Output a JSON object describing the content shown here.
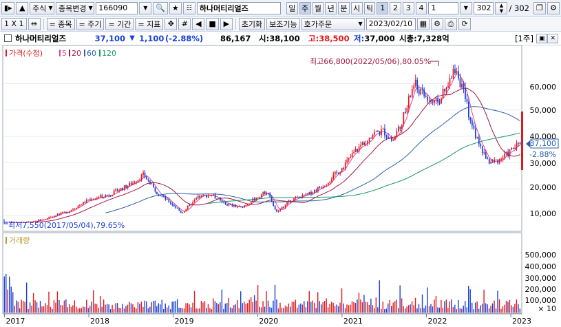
{
  "toolbar1": {
    "market": "주식",
    "change_label": "종목변경",
    "code": "166090",
    "name": "하나머티리얼즈",
    "periods": [
      "일",
      "주",
      "월",
      "년",
      "분",
      "시",
      "틱"
    ],
    "active_period": "주",
    "numbers": [
      "1",
      "2",
      "3",
      "4"
    ],
    "active_number": "1",
    "interval": "1",
    "count": "302",
    "total": "/ 302"
  },
  "toolbar2": {
    "scale": "1 X 1",
    "items": [
      "= 종목",
      "= 주기",
      "= 기간",
      "= 지표"
    ],
    "reset": "초기화",
    "assist": "보조기능",
    "order": "호가주문",
    "date": "2023/02/10"
  },
  "info": {
    "name": "하나머티리얼즈",
    "price": "37,100",
    "down_arrow": "▼",
    "change": "1,100",
    "pct": "(-2.88%)",
    "volume": "86,167",
    "open_label": "시:",
    "open": "38,100",
    "high_label": "고:",
    "high": "38,500",
    "low_label": "저:",
    "low": "37,000",
    "cap": "시총:7,328억",
    "period_tag": "[1주]"
  },
  "legend": {
    "price": "가격(수정)",
    "ma5": "5",
    "ma20": "20",
    "ma60": "60",
    "ma120": "120",
    "volume": "거래량"
  },
  "annotations": {
    "max": "최고66,800(2022/05/06),80.05%",
    "min": "최저7,550(2017/05/04),79.65%"
  },
  "price_axis": {
    "ticks": [
      "60,000",
      "50,000",
      "40,000",
      "30,000",
      "20,000",
      "10,000"
    ],
    "current": "37,100",
    "change_pct": "-2.88%"
  },
  "volume_axis": {
    "ticks": [
      "500,000",
      "400,000",
      "300,000",
      "200,000",
      "100,000"
    ],
    "multiplier": "× 10"
  },
  "x_axis": {
    "years": [
      "2017",
      "2018",
      "2019",
      "2020",
      "2021",
      "2022",
      "2023"
    ]
  },
  "colors": {
    "up": "#e0191e",
    "down": "#1a3fd6",
    "ma5": "#e8409a",
    "ma20": "#a0163c",
    "ma60": "#2c5fa8",
    "ma120": "#159663"
  },
  "chart_data": {
    "type": "candlestick",
    "price_range": [
      7550,
      66800
    ],
    "price_path": [
      [
        2017.3,
        7550
      ],
      [
        2017.5,
        9000
      ],
      [
        2017.75,
        11500
      ],
      [
        2018.0,
        16000
      ],
      [
        2018.25,
        18000
      ],
      [
        2018.5,
        22000
      ],
      [
        2018.65,
        25500
      ],
      [
        2018.8,
        19000
      ],
      [
        2019.0,
        14000
      ],
      [
        2019.1,
        11000
      ],
      [
        2019.3,
        17000
      ],
      [
        2019.45,
        18000
      ],
      [
        2019.6,
        14500
      ],
      [
        2019.8,
        13000
      ],
      [
        2020.0,
        17000
      ],
      [
        2020.12,
        19500
      ],
      [
        2020.22,
        11000
      ],
      [
        2020.4,
        16000
      ],
      [
        2020.6,
        18000
      ],
      [
        2020.8,
        22000
      ],
      [
        2021.0,
        28000
      ],
      [
        2021.15,
        34000
      ],
      [
        2021.35,
        41000
      ],
      [
        2021.5,
        42000
      ],
      [
        2021.6,
        38000
      ],
      [
        2021.75,
        49000
      ],
      [
        2021.85,
        60000
      ],
      [
        2021.95,
        56000
      ],
      [
        2022.1,
        52000
      ],
      [
        2022.25,
        58000
      ],
      [
        2022.35,
        66800
      ],
      [
        2022.45,
        55000
      ],
      [
        2022.55,
        43000
      ],
      [
        2022.65,
        35000
      ],
      [
        2022.75,
        30000
      ],
      [
        2022.85,
        31000
      ],
      [
        2022.95,
        33000
      ],
      [
        2023.05,
        36000
      ],
      [
        2023.11,
        37100
      ]
    ]
  }
}
